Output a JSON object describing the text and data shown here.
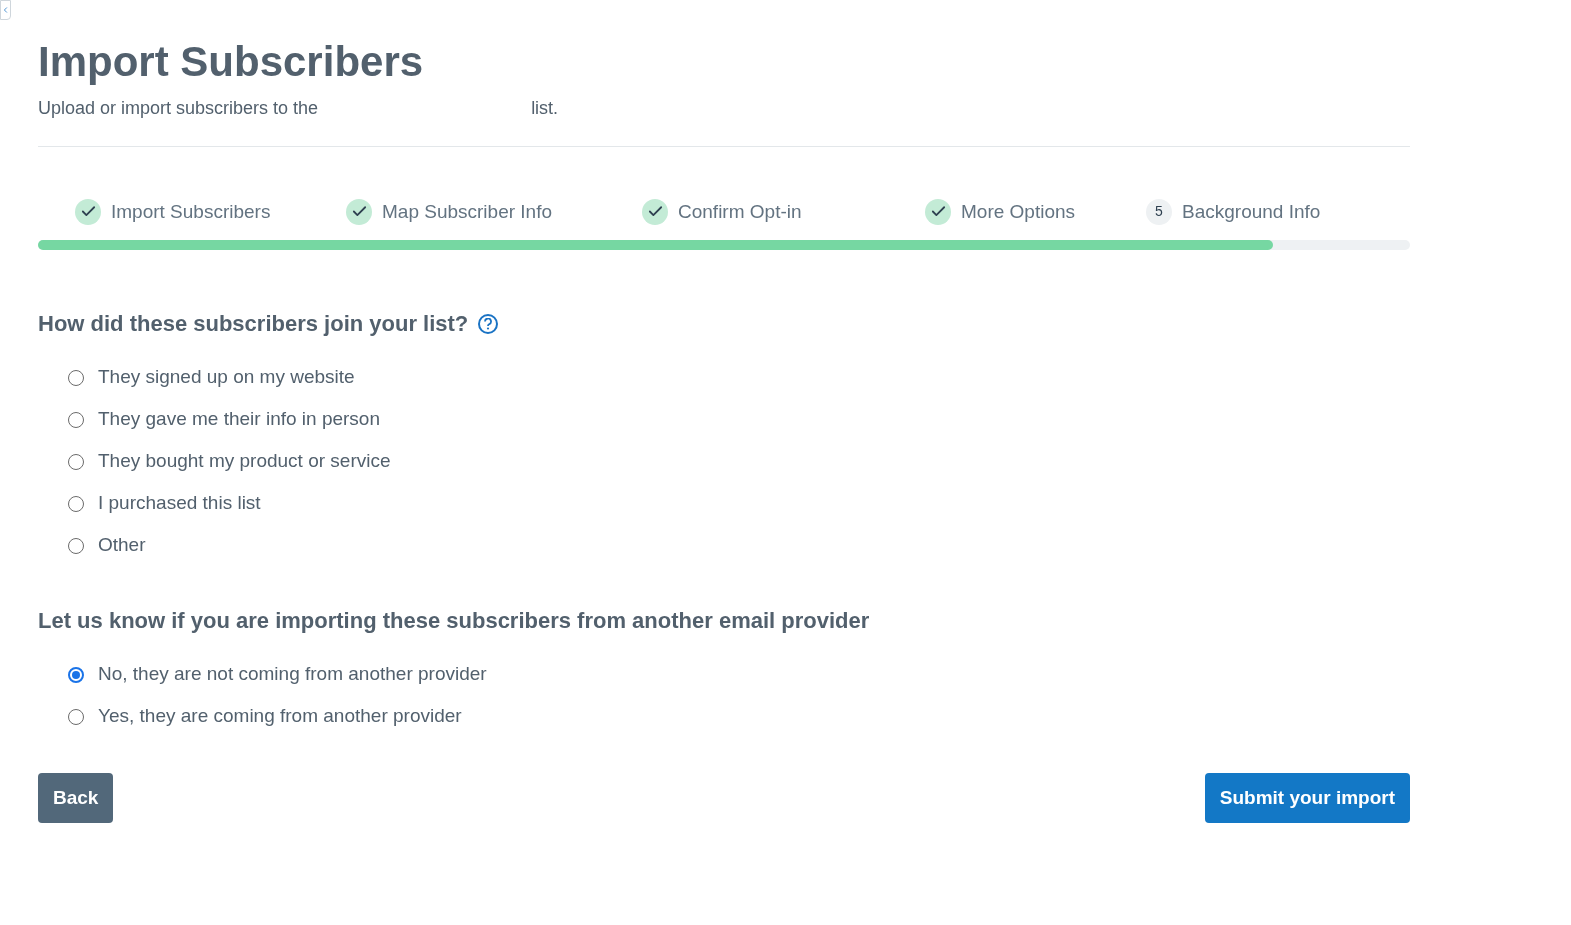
{
  "header": {
    "title": "Import Subscribers",
    "subtitle_before": "Upload or import subscribers to the",
    "subtitle_after": "list."
  },
  "steps": [
    {
      "label": "Import Subscribers",
      "completed": true
    },
    {
      "label": "Map Subscriber Info",
      "completed": true
    },
    {
      "label": "Confirm Opt-in",
      "completed": true
    },
    {
      "label": "More Options",
      "completed": true
    },
    {
      "label": "Background Info",
      "completed": false,
      "number": "5"
    }
  ],
  "progress": {
    "level": 0.9
  },
  "questions": [
    {
      "title": "How did these subscribers join your list?",
      "help": true,
      "options": [
        {
          "label": "They signed up on my website",
          "selected": false
        },
        {
          "label": "They gave me their info in person",
          "selected": false
        },
        {
          "label": "They bought my product or service",
          "selected": false
        },
        {
          "label": "I purchased this list",
          "selected": false
        },
        {
          "label": "Other",
          "selected": false
        }
      ]
    },
    {
      "title": "Let us know if you are importing these subscribers from another email provider",
      "help": false,
      "options": [
        {
          "label": "No, they are not coming from another provider",
          "selected": true
        },
        {
          "label": "Yes, they are coming from another provider",
          "selected": false
        }
      ]
    }
  ],
  "buttons": {
    "back": "Back",
    "submit": "Submit your import"
  }
}
